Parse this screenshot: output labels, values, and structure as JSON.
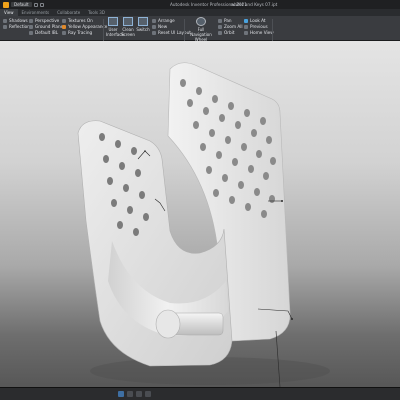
{
  "titlebar": {
    "quick_access_label": "Default",
    "app_title": "Autodesk Inventor Professional 2021",
    "document_name": "wallet and Keys 07.ipt"
  },
  "tabs": [
    {
      "label": "View",
      "active": true
    },
    {
      "label": "Environments",
      "active": false
    },
    {
      "label": "Collaborate",
      "active": false
    },
    {
      "label": "Tools 3D",
      "active": false
    }
  ],
  "ribbon": {
    "appearance": {
      "items": [
        "Shadows",
        "Reflections"
      ],
      "items2": [
        "Perspective",
        "Ground Plane",
        "Default IBL"
      ],
      "items3": [
        "Textures On",
        "Yellow Appearance",
        "Ray Tracing"
      ],
      "label": "Appearance"
    },
    "windows": {
      "user_interface": "User Interface",
      "clean_screen": "Clean Screen",
      "switch": "Switch",
      "items": [
        "Arrange",
        "New",
        "Reset UI Layout"
      ],
      "label": "Windows"
    },
    "navigate": {
      "full_nav": "Full Navigation Wheel",
      "items": [
        "Pan",
        "Zoom All",
        "Orbit"
      ],
      "items2": [
        "Look At",
        "Previous",
        "Home View"
      ],
      "label": "Navigate"
    }
  },
  "viewport": {
    "model": "3D part: hook bracket with perforated back plate and peg",
    "accent_colors": {
      "background_top": "#e4e4e4",
      "background_bottom": "#575757",
      "part": "#e6e6e6"
    }
  }
}
